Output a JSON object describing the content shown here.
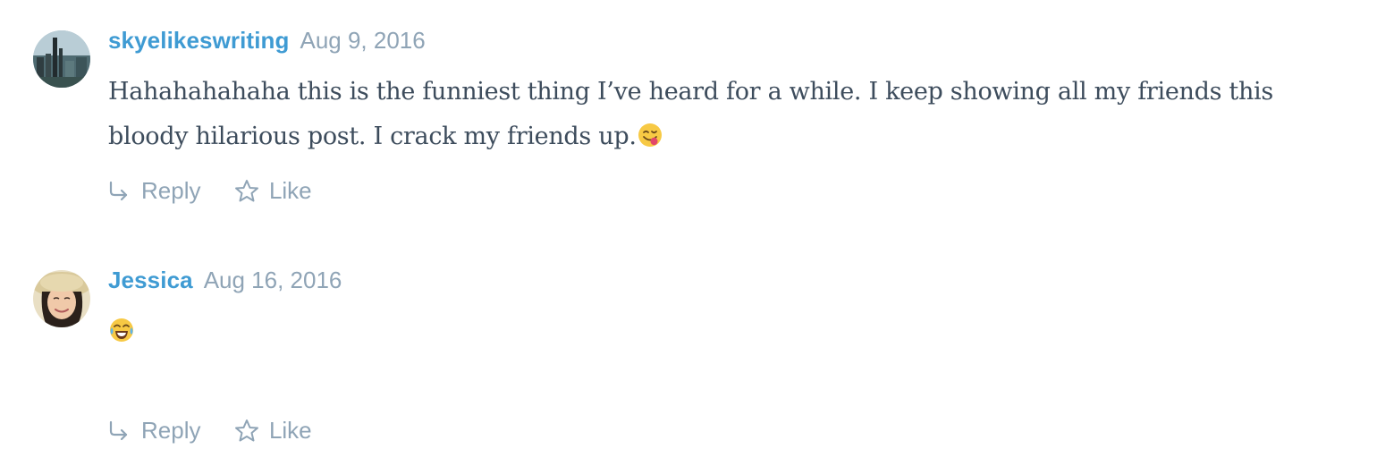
{
  "comments": [
    {
      "author": "skyelikeswriting",
      "date": "Aug 9, 2016",
      "text": "Hahahahahaha this is the funniest thing I’ve heard for a while. I keep showing all my friends this bloody hilarious post. I crack my friends up.",
      "emoji": "face-savoring-food-icon",
      "reply_label": "Reply",
      "like_label": "Like"
    },
    {
      "author": "Jessica",
      "date": "Aug 16, 2016",
      "text": "",
      "emoji": "face-with-tears-of-joy-icon",
      "reply_label": "Reply",
      "like_label": "Like"
    }
  ],
  "colors": {
    "author_link": "#3f9bd3",
    "meta_gray": "#8fa4b6",
    "body_text": "#3d4c5c"
  }
}
